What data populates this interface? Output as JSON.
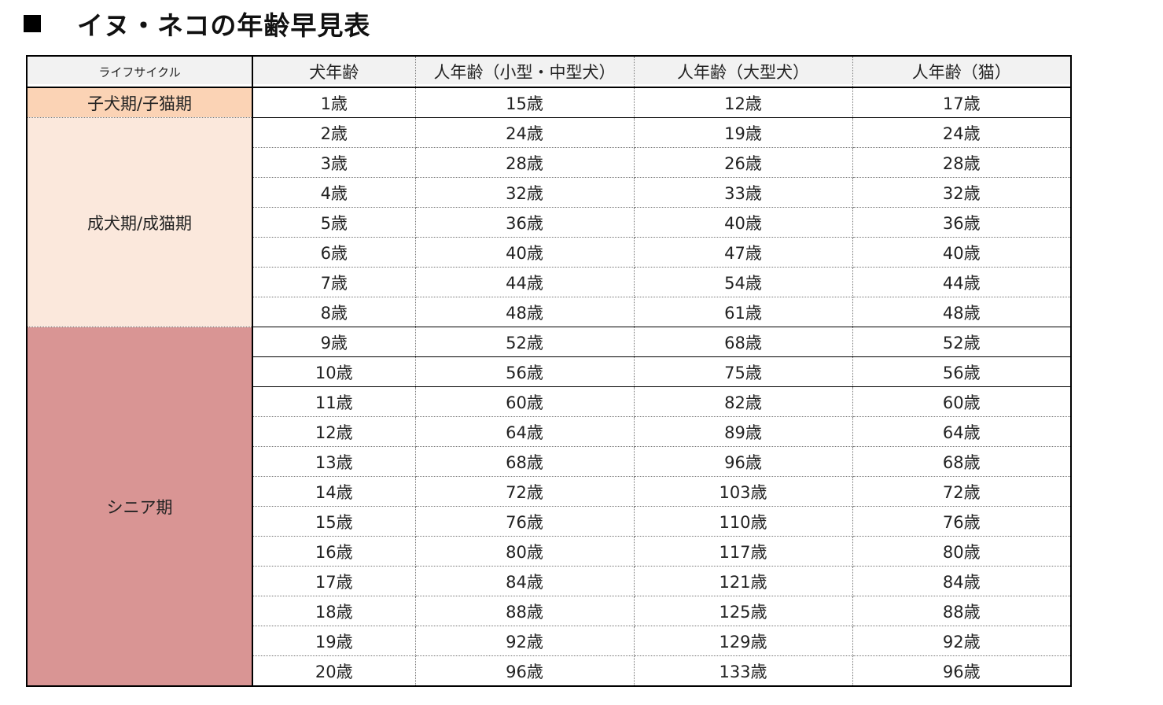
{
  "title": "イヌ・ネコの年齢早見表",
  "colors": {
    "header_bg": "#f2f2f2",
    "puppy_bg": "#fbd3b5",
    "adult_bg": "#fbe8dc",
    "senior_bg": "#d99594"
  },
  "columns": {
    "lifecycle": "ライフサイクル",
    "dog_age": "犬年齢",
    "human_small_medium": "人年齢（小型・中型犬）",
    "human_large": "人年齢（大型犬）",
    "human_cat": "人年齢（猫）"
  },
  "stages": [
    {
      "label": "子犬期/子猫期",
      "color": "#fbd3b5",
      "rows": 1
    },
    {
      "label": "成犬期/成猫期",
      "color": "#fbe8dc",
      "rows": 7
    },
    {
      "label": "シニア期",
      "color": "#d99594",
      "rows": 12
    }
  ],
  "rows": [
    {
      "dog": "1歳",
      "small": "15歳",
      "large": "12歳",
      "cat": "17歳"
    },
    {
      "dog": "2歳",
      "small": "24歳",
      "large": "19歳",
      "cat": "24歳"
    },
    {
      "dog": "3歳",
      "small": "28歳",
      "large": "26歳",
      "cat": "28歳"
    },
    {
      "dog": "4歳",
      "small": "32歳",
      "large": "33歳",
      "cat": "32歳"
    },
    {
      "dog": "5歳",
      "small": "36歳",
      "large": "40歳",
      "cat": "36歳"
    },
    {
      "dog": "6歳",
      "small": "40歳",
      "large": "47歳",
      "cat": "40歳"
    },
    {
      "dog": "7歳",
      "small": "44歳",
      "large": "54歳",
      "cat": "44歳"
    },
    {
      "dog": "8歳",
      "small": "48歳",
      "large": "61歳",
      "cat": "48歳"
    },
    {
      "dog": "9歳",
      "small": "52歳",
      "large": "68歳",
      "cat": "52歳"
    },
    {
      "dog": "10歳",
      "small": "56歳",
      "large": "75歳",
      "cat": "56歳"
    },
    {
      "dog": "11歳",
      "small": "60歳",
      "large": "82歳",
      "cat": "60歳"
    },
    {
      "dog": "12歳",
      "small": "64歳",
      "large": "89歳",
      "cat": "64歳"
    },
    {
      "dog": "13歳",
      "small": "68歳",
      "large": "96歳",
      "cat": "68歳"
    },
    {
      "dog": "14歳",
      "small": "72歳",
      "large": "103歳",
      "cat": "72歳"
    },
    {
      "dog": "15歳",
      "small": "76歳",
      "large": "110歳",
      "cat": "76歳"
    },
    {
      "dog": "16歳",
      "small": "80歳",
      "large": "117歳",
      "cat": "80歳"
    },
    {
      "dog": "17歳",
      "small": "84歳",
      "large": "121歳",
      "cat": "84歳"
    },
    {
      "dog": "18歳",
      "small": "88歳",
      "large": "125歳",
      "cat": "88歳"
    },
    {
      "dog": "19歳",
      "small": "92歳",
      "large": "129歳",
      "cat": "92歳"
    },
    {
      "dog": "20歳",
      "small": "96歳",
      "large": "133歳",
      "cat": "96歳"
    }
  ]
}
